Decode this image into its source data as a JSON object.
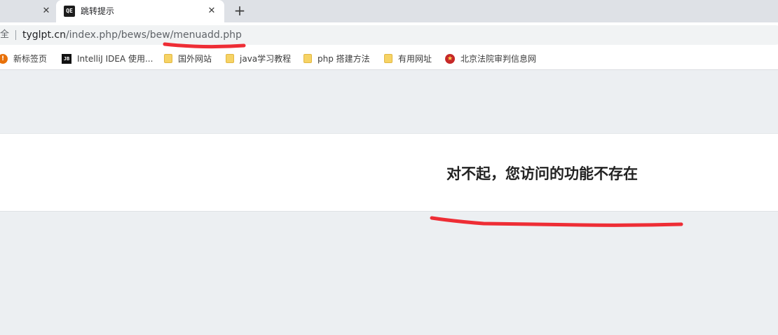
{
  "browser": {
    "tabs": [
      {
        "title": "",
        "close_glyph": "✕",
        "favicon": ""
      },
      {
        "title": "跳转提示",
        "close_glyph": "✕",
        "favicon": "QE"
      }
    ],
    "new_tab_glyph": "+",
    "address": {
      "secure_label": "安全",
      "url_host": "tyglpt.cn",
      "url_path": "/index.php/bews/bew/menuadd.php"
    },
    "bookmarks": [
      {
        "label": "新标签页",
        "icon": "new-tab-icon"
      },
      {
        "label": "IntelliJ IDEA 使用...",
        "icon": "jetbrains-icon"
      },
      {
        "label": "国外网站",
        "icon": "folder-icon"
      },
      {
        "label": "java学习教程",
        "icon": "folder-icon"
      },
      {
        "label": "php 搭建方法",
        "icon": "folder-icon"
      },
      {
        "label": "有用网址",
        "icon": "folder-icon"
      },
      {
        "label": "北京法院审判信息网",
        "icon": "court-emblem-icon"
      }
    ]
  },
  "page": {
    "message": "对不起，您访问的功能不存在"
  },
  "colors": {
    "annotation": "#ee2d35",
    "page_bg": "#eceff2",
    "band_bg": "#ffffff"
  }
}
